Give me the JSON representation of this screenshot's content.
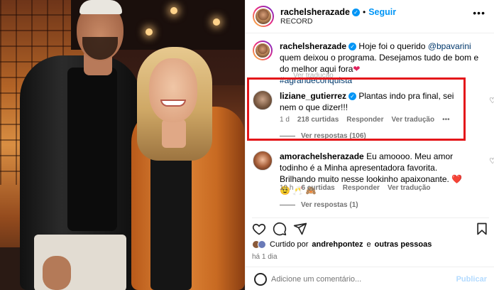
{
  "post": {
    "author": "rachelsherazade",
    "follow_label": "Seguir",
    "location": "RECORD",
    "more": "•••",
    "caption_author": "rachelsherazade",
    "caption_part1": "Hoje foi o querido ",
    "caption_mention": "@bpavarini",
    "caption_part2": " quem deixou o programa. Desejamos tudo de bom e do melhor aqui fora",
    "caption_emoji": "❤",
    "caption_hashtag": "#agrandeconquista",
    "caption_faded": "Ver tradução"
  },
  "comments": [
    {
      "user": "liziane_gutierrez",
      "text": "Plantas indo pra final, sei nem o que dizer!!!",
      "age": "1 d",
      "likes": "218 curtidas",
      "reply": "Responder",
      "translate": "Ver tradução",
      "more": "•••",
      "replies": "Ver respostas (106)"
    },
    {
      "user": "amorachelsherazade",
      "text": "Eu amoooo. Meu amor todinho é a Minha apresentadora favorita. Brilhando muito nesse lookinho apaixonante. ❤️ 😉 🥂 🙈",
      "age": "19 h",
      "likes": "6 curtidas",
      "reply": "Responder",
      "translate": "Ver tradução",
      "replies": "Ver respostas (1)"
    }
  ],
  "liked_by": {
    "prefix": "Curtido por ",
    "user": "andrehpontez",
    "suffix": " e ",
    "others": "outras pessoas"
  },
  "time_ago": "há 1 dia",
  "add_comment": {
    "placeholder": "Adicione um comentário...",
    "post": "Publicar"
  },
  "colors": {
    "highlight": "#e4161a",
    "link": "#00376b",
    "verified": "#0095f6"
  }
}
